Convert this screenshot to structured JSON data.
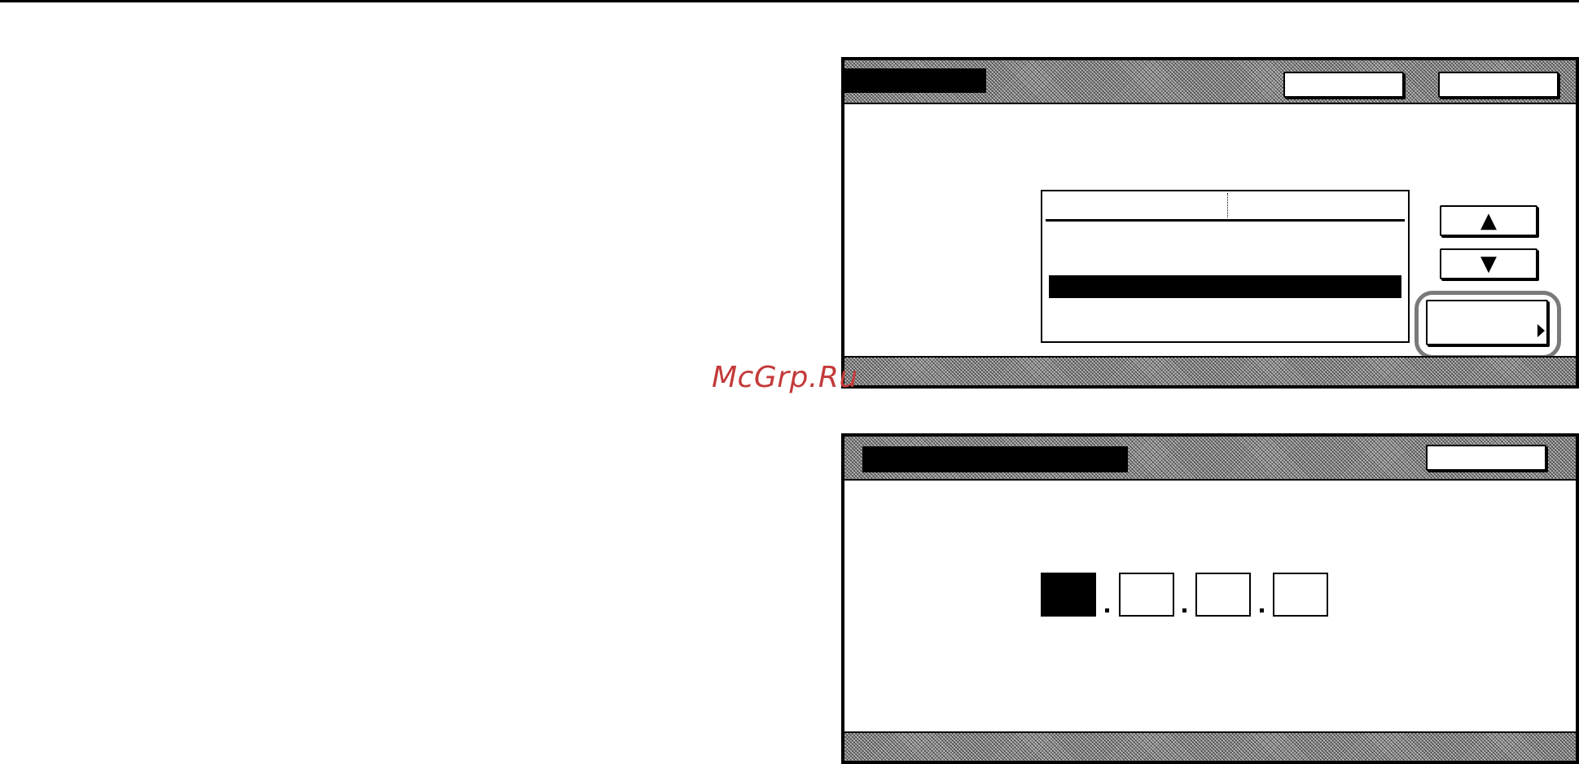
{
  "watermark": "McGrp.Ru",
  "screen1": {
    "scroll_up_icon": "▲",
    "scroll_down_icon": "▼",
    "list_rows": [
      "",
      ""
    ]
  },
  "screen2": {
    "ip_fields": [
      "",
      "",
      "",
      ""
    ]
  },
  "colors": {
    "watermark": "#c43a3a",
    "highlight_ring": "#7a7a7a"
  }
}
